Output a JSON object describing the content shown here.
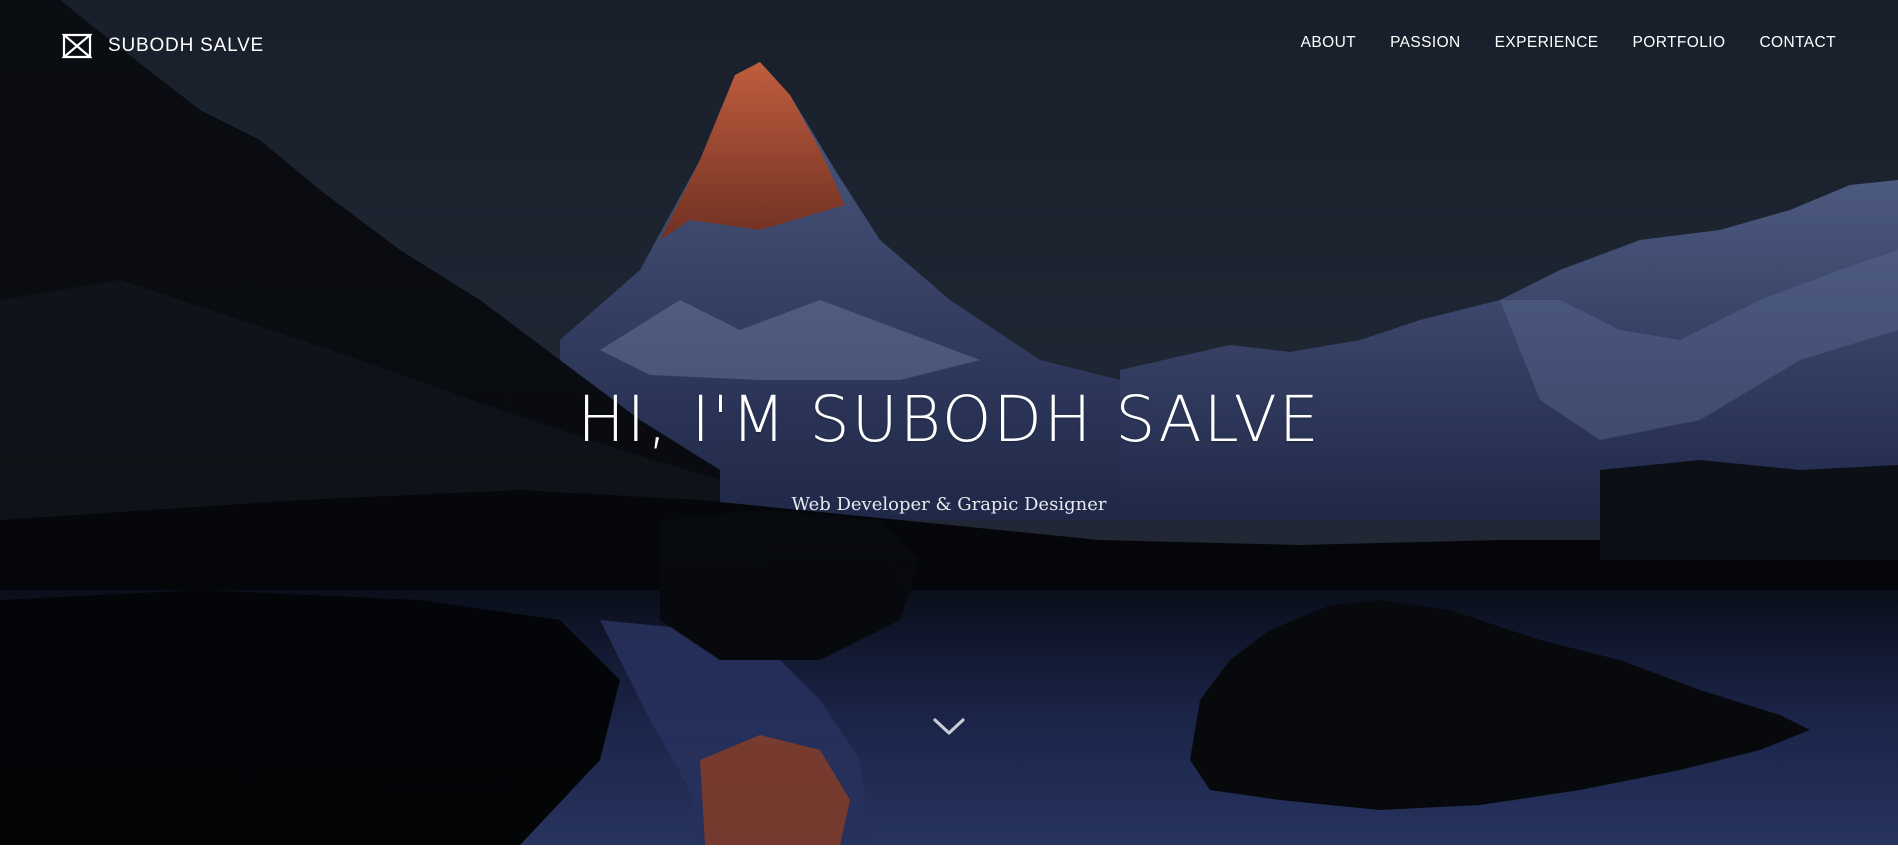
{
  "brand": {
    "name": "SUBODH SALVE",
    "icon": "bowtie-logo-icon"
  },
  "nav": {
    "items": [
      {
        "label": "ABOUT"
      },
      {
        "label": "PASSION"
      },
      {
        "label": "EXPERIENCE"
      },
      {
        "label": "PORTFOLIO"
      },
      {
        "label": "CONTACT"
      }
    ]
  },
  "hero": {
    "title": "HI, I'M SUBODH SALVE",
    "subtitle": "Web Developer & Grapic Designer",
    "scroll_icon": "chevron-down-icon",
    "background": "mountain-lake-photo"
  },
  "colors": {
    "text": "#ffffff",
    "overlay_dark": "#1d2633",
    "water_blue": "#3a4f8f",
    "peak_glow": "#d8633a"
  }
}
